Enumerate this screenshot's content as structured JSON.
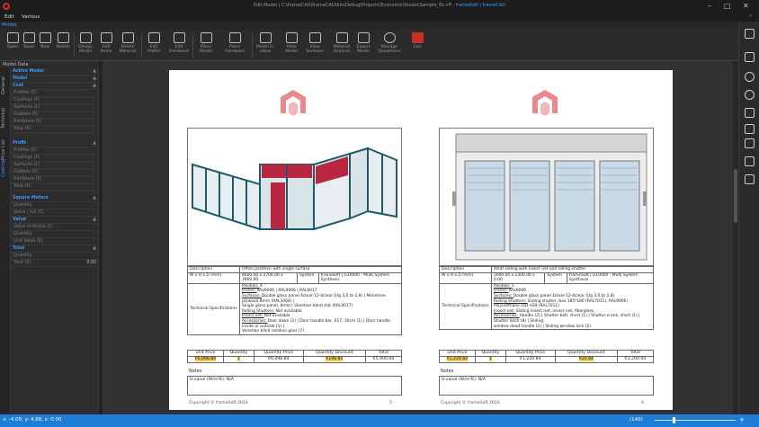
{
  "window": {
    "title": "Edit Model | C:\\frameCAD\\frameCAD\\bin\\Debug\\Projects\\Economic\\Studio\\Sample_Ex.cff",
    "title_sep": " - ",
    "app_name": "frameSoft | frameCAD",
    "minimize": "–",
    "maximize": "□",
    "close": "✕"
  },
  "menu": {
    "items": [
      "Edit",
      "Various"
    ],
    "right_glyph": "⌃"
  },
  "ribbon": {
    "active_tab": "Model",
    "buttons": [
      {
        "label": "Open",
        "icon": "folder-icon"
      },
      {
        "label": "Save",
        "icon": "save-icon"
      },
      {
        "label": "New",
        "icon": "new-icon"
      },
      {
        "label": "Delete",
        "icon": "delete-icon"
      },
      {
        "label": "Design Model",
        "icon": "design-icon"
      },
      {
        "label": "Add Items",
        "icon": "add-items-icon"
      },
      {
        "label": "Delete Material",
        "icon": "eraser-icon"
      },
      {
        "label": "Edit Profile",
        "icon": "profile-icon"
      },
      {
        "label": "Edit Hardware",
        "icon": "hardware-icon"
      },
      {
        "label": "Place Model",
        "icon": "place-model-icon"
      },
      {
        "label": "Place Hardware",
        "icon": "place-hardware-icon"
      },
      {
        "label": "Model U-value",
        "icon": "u-value-icon"
      },
      {
        "label": "View Model",
        "icon": "view-model-icon"
      },
      {
        "label": "View Sections",
        "icon": "view-sections-icon"
      },
      {
        "label": "Material Analysis",
        "icon": "analysis-icon"
      },
      {
        "label": "Export Model",
        "icon": "export-icon"
      },
      {
        "label": "Manage Quotations",
        "icon": "euro-icon"
      },
      {
        "label": "Exit",
        "icon": "exit-icon"
      }
    ]
  },
  "panel": {
    "header": "Model Data",
    "tabs": [
      "General",
      "Technical",
      "Price List",
      "Costing"
    ],
    "active_tab": "Costing",
    "rows": [
      {
        "type": "cat",
        "key": "Active Model"
      },
      {
        "type": "cat",
        "key": "Model"
      },
      {
        "type": "cat",
        "key": "Cost"
      },
      {
        "type": "row",
        "key": "Profiles (€)",
        "value": ""
      },
      {
        "type": "row",
        "key": "Coatings (€)",
        "value": ""
      },
      {
        "type": "row",
        "key": "Surfaces (€)",
        "value": ""
      },
      {
        "type": "row",
        "key": "Gaskets (€)",
        "value": ""
      },
      {
        "type": "row",
        "key": "Hardware (€)",
        "value": ""
      },
      {
        "type": "row",
        "key": "Total (€)",
        "value": ""
      },
      {
        "type": "cat",
        "key": "Profit"
      },
      {
        "type": "row",
        "key": "Profiles (€)",
        "value": ""
      },
      {
        "type": "row",
        "key": "Coatings (€)",
        "value": ""
      },
      {
        "type": "row",
        "key": "Surfaces (€)",
        "value": ""
      },
      {
        "type": "row",
        "key": "Gaskets (€)",
        "value": ""
      },
      {
        "type": "row",
        "key": "Hardware (€)",
        "value": ""
      },
      {
        "type": "row",
        "key": "Total (€)",
        "value": ""
      },
      {
        "type": "cat",
        "key": "Square Meters"
      },
      {
        "type": "row",
        "key": "Quantity",
        "value": ""
      },
      {
        "type": "row",
        "key": "Value / m2 (€)",
        "value": ""
      },
      {
        "type": "cat",
        "key": "Value"
      },
      {
        "type": "row",
        "key": "Value of Active (€)",
        "value": ""
      },
      {
        "type": "row",
        "key": "Quantity",
        "value": ""
      },
      {
        "type": "row",
        "key": "Unit Value (€)",
        "value": ""
      },
      {
        "type": "cat",
        "key": "Total"
      },
      {
        "type": "row",
        "key": "Quantity",
        "value": ""
      },
      {
        "type": "row",
        "key": "Total (€)",
        "value": "0.00"
      }
    ]
  },
  "pages": [
    {
      "description": "Office partition with single surface",
      "dims_label": "W x H x D (mm)",
      "dims": "8600.00 x 2700.00 x 3900.00",
      "system_label": "System",
      "system": "frameSoft | G10000 - Multi System Synthesis",
      "tech_label": "Technical Specifications",
      "spec_lines": [
        {
          "head": "Position: ",
          "text": "4"
        },
        {
          "head": "Frame: ",
          "text": "RAL9006 | RAL9006 | RAL9017"
        },
        {
          "head": "Surfaces: ",
          "text": "Double glass panel 4clear-12-4clear (Ug 3,0 to 1,8) | Melamine plywood 8mm (RAL3004) |"
        },
        {
          "head": "",
          "text": "Single glass panel, 8mm | Venetian blind slat (RAL9017)"
        },
        {
          "head": "Rolling Shutters: ",
          "text": "Not available"
        },
        {
          "head": "Insect net: ",
          "text": "Not available"
        },
        {
          "head": "Accessories: ",
          "text": "Door down (2) | Door handle bar, 017, 30cm (1) | Door handle inside or outside (1) |"
        },
        {
          "head": "",
          "text": "Venetian blind rotation gear (7)"
        }
      ],
      "price_headers": [
        "Unit Price",
        "Quantity",
        "Quantity Price",
        "Quantity Discount",
        "Total"
      ],
      "price_values": [
        "€6,098.84",
        "1",
        "€6,098.84",
        "€198.84",
        "€5,900.00"
      ],
      "notes_label": "Notes",
      "notes": "U-value (W/m²K): N/A",
      "copyright": "Copyright © frameSoft 2016",
      "page_num": "5"
    },
    {
      "description": "4leaf sliding with insect net and rolling shutter",
      "dims_label": "W x H x D (mm)",
      "dims": "2000.00 x 1200.00 x 0.00",
      "system_label": "System",
      "system": "frameSoft | G10000 - Multi System Synthesis",
      "tech_label": "Technical Specifications",
      "spec_lines": [
        {
          "head": "Position: ",
          "text": "5"
        },
        {
          "head": "Frame: ",
          "text": "RAL9006"
        },
        {
          "head": "Surfaces: ",
          "text": "Double glass panel 4clear-12-4clear (Ug 3,0 to 1,8)"
        },
        {
          "head": "Rolling Shutters: ",
          "text": "Sliding shutter, box 185*180 (RAL7011), RAL9006) Polyurethane slat H39 (RAL7011)"
        },
        {
          "head": "Insect net: ",
          "text": "Sliding insect net, insect net, fiberglass"
        },
        {
          "head": "Accessories: ",
          "text": "Handle (2) | Shutter belt, short (1) | Shutter crank, short (1) | Shutter latch (8) | Sliding"
        },
        {
          "head": "",
          "text": "window dead handle (2) | Sliding window lock (2)"
        }
      ],
      "price_headers": [
        "Unit Price",
        "Quantity",
        "Quantity Price",
        "Quantity Discount",
        "Total"
      ],
      "price_values": [
        "€1,220.84",
        "1",
        "€1,220.84",
        "€20.84",
        "€1,200.00"
      ],
      "notes_label": "Notes",
      "notes": "U-value (W/m²K): N/A",
      "copyright": "Copyright © frameSoft 2016",
      "page_num": "6"
    }
  ],
  "status": {
    "coords": "x: -4.00, y: 4.88, z: 0.00",
    "zoom": "(140)"
  },
  "colors": {
    "accent": "#1c7ed6",
    "highlight": "#f0c84a",
    "brand": "#e07070"
  }
}
